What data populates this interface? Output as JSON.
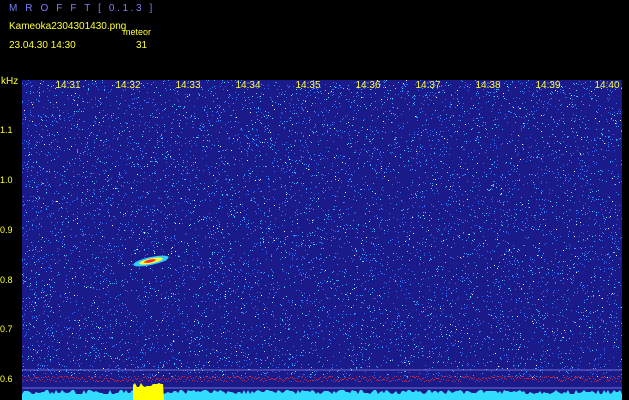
{
  "header": {
    "app_title": "M R O F F T  [ 0.1.3 ]",
    "file_name": "Kameoka2304301430.png",
    "detect_label": "meteor",
    "date_time": "23.04.30  14:30",
    "count": "31"
  },
  "axis": {
    "unit": "kHz",
    "time_labels": [
      "14:31",
      "14:32",
      "14:33",
      "14:34",
      "14:35",
      "14:36",
      "14:37",
      "14:38",
      "14:39",
      "14:40"
    ],
    "freq_labels": [
      "1.1",
      "1.0",
      "0.9",
      "0.8",
      "0.7",
      "0.6"
    ]
  },
  "colors": {
    "background": "#1a1a8a",
    "noise": [
      "#2a6cff",
      "#33aaff",
      "#55e6ff",
      "#ffffff"
    ],
    "level_bar": "#33ddff",
    "detection_bar": "#ffff00",
    "echo": "#ff3333"
  }
}
